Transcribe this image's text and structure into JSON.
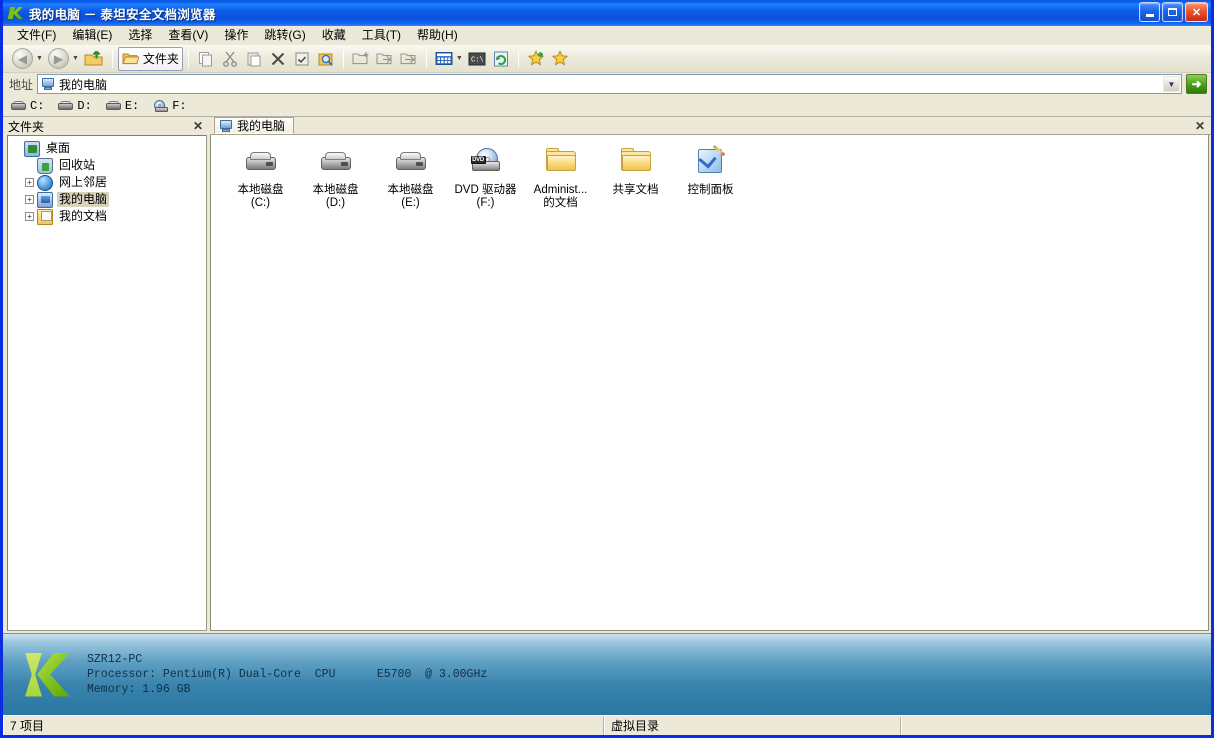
{
  "window": {
    "title": "我的电脑 － 泰坦安全文档浏览器",
    "app_icon": "green-k-logo-icon",
    "controls": {
      "minimize": "minimize-button",
      "maximize": "maximize-button",
      "close": "close-button"
    }
  },
  "menubar": {
    "items": [
      {
        "label": "文件(F)"
      },
      {
        "label": "编辑(E)"
      },
      {
        "label": "选择"
      },
      {
        "label": "查看(V)"
      },
      {
        "label": "操作"
      },
      {
        "label": "跳转(G)"
      },
      {
        "label": "收藏"
      },
      {
        "label": "工具(T)"
      },
      {
        "label": "帮助(H)"
      }
    ]
  },
  "toolbar": {
    "back": "back-icon",
    "forward": "forward-icon",
    "up": "up-folder-icon",
    "folders_label": "文件夹",
    "folders_icon": "open-folder-icon",
    "copy": "copy-icon",
    "cut": "cut-icon",
    "paste": "paste-icon",
    "delete": "delete-x-icon",
    "properties": "properties-icon",
    "search": "search-folder-icon",
    "new_folder": "new-folder-icon",
    "move_to": "move-to-folder-icon",
    "copy_to": "copy-to-folder-icon",
    "views": "views-icon",
    "views_caret": "chevron-down-icon",
    "console": "command-prompt-icon",
    "refresh": "refresh-icon",
    "add_favorite": "add-favorite-star-icon",
    "favorites": "favorites-star-icon"
  },
  "address": {
    "label": "地址",
    "value": "我的电脑",
    "placeholder": "我的电脑",
    "icon": "my-computer-icon",
    "dropdown": "chevron-down-icon",
    "go_button": "go-arrow-icon"
  },
  "drivebar": {
    "drives": [
      {
        "label": "C:",
        "icon": "hard-disk-icon"
      },
      {
        "label": "D:",
        "icon": "hard-disk-icon"
      },
      {
        "label": "E:",
        "icon": "hard-disk-icon"
      },
      {
        "label": "F:",
        "icon": "cd-drive-icon"
      }
    ]
  },
  "folderpane": {
    "header": "文件夹",
    "close": "close-icon",
    "tree": [
      {
        "label": "桌面",
        "icon": "desktop-icon",
        "expander": "",
        "selected": false
      },
      {
        "label": "回收站",
        "icon": "recycle-bin-icon",
        "expander": "",
        "selected": false
      },
      {
        "label": "网上邻居",
        "icon": "network-places-icon",
        "expander": "+",
        "selected": false
      },
      {
        "label": "我的电脑",
        "icon": "my-computer-icon",
        "expander": "+",
        "selected": true
      },
      {
        "label": "我的文档",
        "icon": "my-documents-icon",
        "expander": "+",
        "selected": false
      }
    ]
  },
  "tabstrip": {
    "tabs": [
      {
        "label": "我的电脑",
        "icon": "my-computer-icon",
        "active": true
      }
    ],
    "close": "close-icon"
  },
  "files": {
    "items": [
      {
        "name": "本地磁盘\n(C:)",
        "icon": "hard-disk-icon"
      },
      {
        "name": "本地磁盘\n(D:)",
        "icon": "hard-disk-icon"
      },
      {
        "name": "本地磁盘\n(E:)",
        "icon": "hard-disk-icon"
      },
      {
        "name": "DVD 驱动器\n(F:)",
        "icon": "dvd-drive-icon",
        "badge": "DVD"
      },
      {
        "name": "Administ...\n的文档",
        "icon": "folder-icon"
      },
      {
        "name": "共享文档",
        "icon": "folder-icon"
      },
      {
        "name": "控制面板",
        "icon": "control-panel-icon"
      }
    ]
  },
  "sysinfo": {
    "logo": "green-k-logo-icon",
    "text": "SZR12-PC\nProcessor: Pentium(R) Dual-Core  CPU      E5700  @ 3.00GHz\nMemory: 1.96 GB"
  },
  "statusbar": {
    "item_count": "7 项目",
    "middle": "虚拟目录",
    "right": ""
  },
  "colors": {
    "title_blue": "#0a59e8",
    "chrome_beige": "#ece9d8",
    "sysinfo_blue": "#2b78a3",
    "accent_green": "#7fc11c",
    "selection": "#d8d4bc"
  }
}
